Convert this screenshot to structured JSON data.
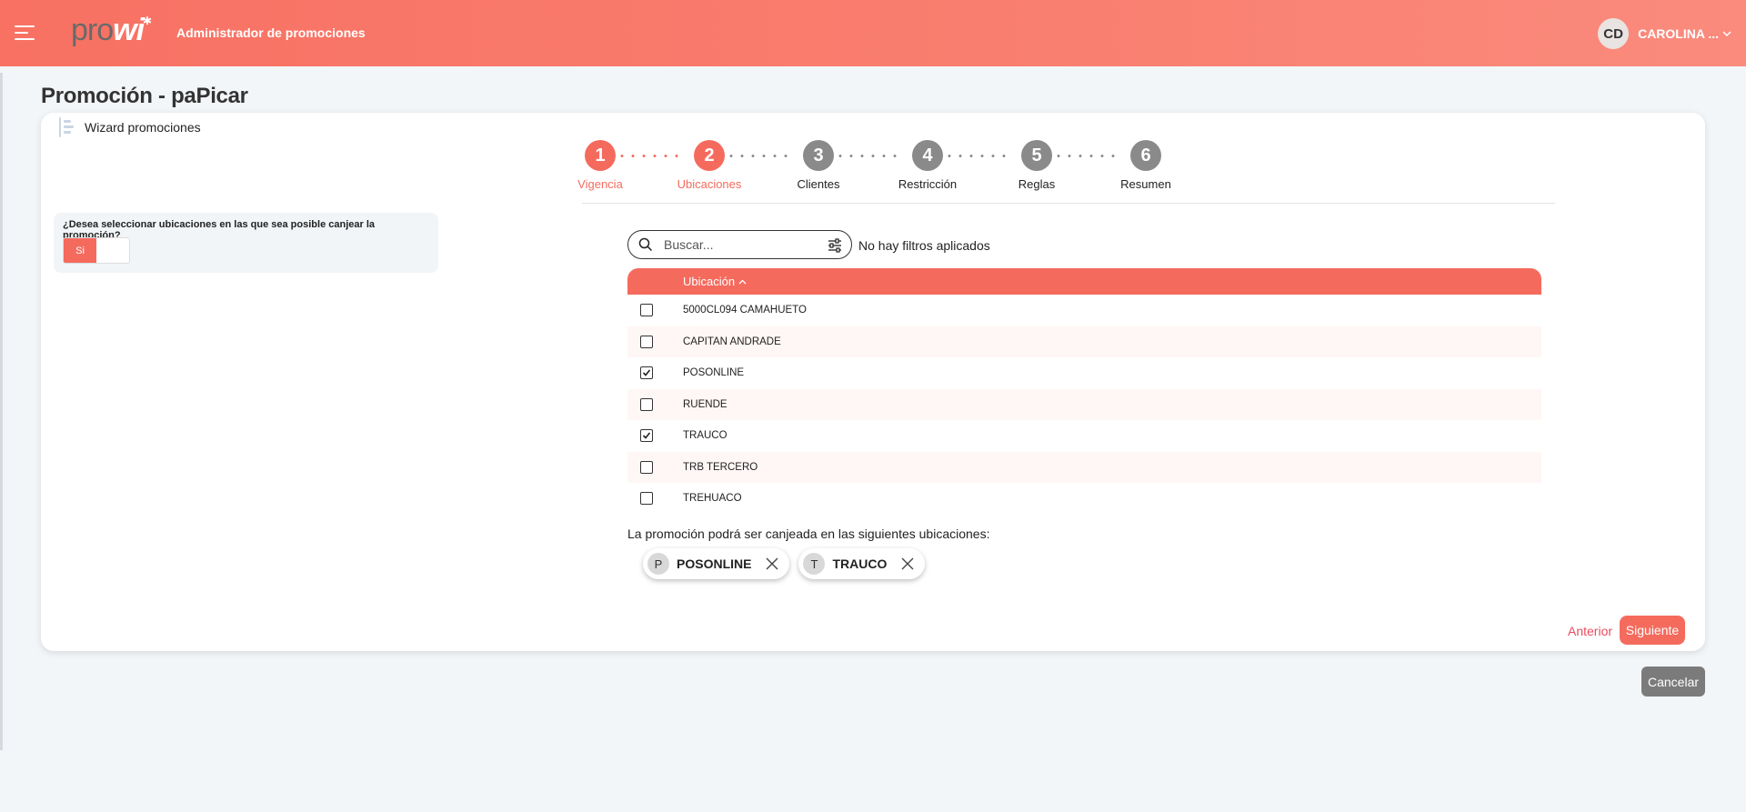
{
  "header": {
    "logo_text": "prowi",
    "app_title": "Administrador de promociones",
    "user_initials": "CD",
    "user_name": "CAROLINA ..."
  },
  "page": {
    "title": "Promoción - paPicar",
    "wizard_label": "Wizard promociones"
  },
  "steps": [
    {
      "number": "1",
      "label": "Vigencia",
      "state": "done"
    },
    {
      "number": "2",
      "label": "Ubicaciones",
      "state": "current"
    },
    {
      "number": "3",
      "label": "Clientes",
      "state": "pending"
    },
    {
      "number": "4",
      "label": "Restricción",
      "state": "pending"
    },
    {
      "number": "5",
      "label": "Reglas",
      "state": "pending"
    },
    {
      "number": "6",
      "label": "Resumen",
      "state": "pending"
    }
  ],
  "question": {
    "text": "¿Desea seleccionar ubicaciones en las que sea posible canjear la promoción?",
    "toggle_value": "Si"
  },
  "search": {
    "placeholder": "Buscar...",
    "filter_status": "No hay filtros aplicados"
  },
  "table": {
    "column_header": "Ubicación",
    "rows": [
      {
        "name": "5000CL094 CAMAHUETO",
        "checked": false
      },
      {
        "name": "CAPITAN ANDRADE",
        "checked": false
      },
      {
        "name": "POSONLINE",
        "checked": true
      },
      {
        "name": "RUENDE",
        "checked": false
      },
      {
        "name": "TRAUCO",
        "checked": true
      },
      {
        "name": "TRB TERCERO",
        "checked": false
      },
      {
        "name": "TREHUACO",
        "checked": false
      }
    ]
  },
  "selection": {
    "info_text": "La promoción podrá ser canjeada en las siguientes ubicaciones:",
    "chips": [
      {
        "initial": "P",
        "label": "POSONLINE"
      },
      {
        "initial": "T",
        "label": "TRAUCO"
      }
    ]
  },
  "actions": {
    "previous": "Anterior",
    "next": "Siguiente",
    "cancel": "Cancelar"
  },
  "colors": {
    "accent": "#f46b5e",
    "header_gradient_start": "#f87163",
    "step_inactive": "#8a8a8a"
  }
}
